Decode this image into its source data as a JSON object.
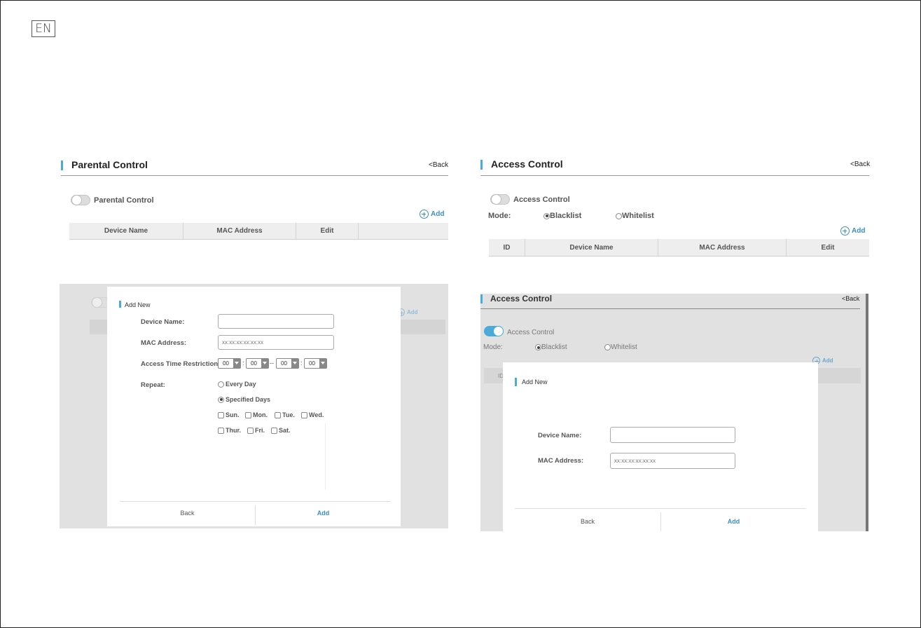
{
  "lang_badge": "EN",
  "parental": {
    "title": "Parental Control",
    "back": "<Back",
    "toggle_label": "Parental Control",
    "add": "Add",
    "columns": [
      "Device Name",
      "MAC Address",
      "Edit"
    ]
  },
  "access": {
    "title": "Access Control",
    "back": "<Back",
    "toggle_label": "Access Control",
    "mode_label": "Mode:",
    "mode_options": [
      "Blacklist",
      "Whitelist"
    ],
    "mode_selected": "Blacklist",
    "add": "Add",
    "columns": [
      "ID",
      "Device Name",
      "MAC Address",
      "Edit"
    ]
  },
  "parental_modal": {
    "bg_add": "Add",
    "title": "Add New",
    "device_name_label": "Device Name:",
    "device_name_value": "",
    "mac_label": "MAC Address:",
    "mac_placeholder": "xx:xx:xx:xx:xx:xx",
    "time_label": "Access Time Restriction:",
    "time_values": [
      "00",
      "00",
      "00",
      "00"
    ],
    "time_colon": ":",
    "time_dash": "--",
    "repeat_label": "Repeat:",
    "repeat_options": [
      "Every Day",
      "Specified Days"
    ],
    "repeat_selected": "Specified Days",
    "days": [
      "Sun.",
      "Mon.",
      "Tue.",
      "Wed.",
      "Thur.",
      "Fri.",
      "Sat."
    ],
    "back_button": "Back",
    "add_button": "Add"
  },
  "access_modal": {
    "bg_title": "Access Control",
    "bg_back": "<Back",
    "bg_toggle_label": "Access Control",
    "bg_mode_label": "Mode:",
    "bg_mode_options": [
      "Blacklist",
      "Whitelist"
    ],
    "bg_add": "Add",
    "bg_id": "ID",
    "title": "Add New",
    "device_name_label": "Device Name:",
    "device_name_value": "",
    "mac_label": "MAC Address:",
    "mac_placeholder": "xx:xx:xx:xx:xx:xx",
    "back_button": "Back",
    "add_button": "Add"
  },
  "colors": {
    "accent": "#4aaad8",
    "link": "#3a8fc4",
    "overlay": "#e1e1e1"
  }
}
